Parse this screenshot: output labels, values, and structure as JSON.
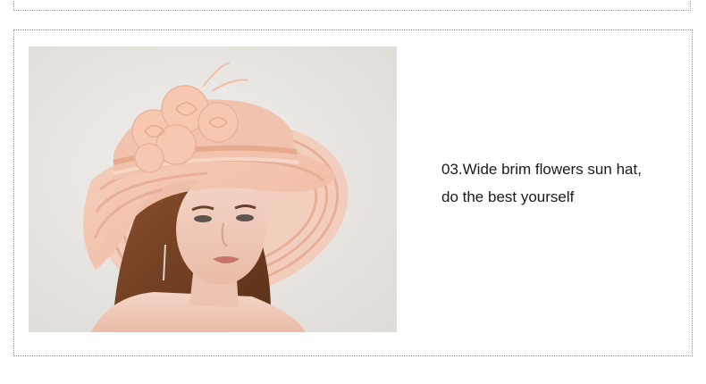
{
  "product": {
    "image_icon": "hat-photo",
    "caption_line1": "03.Wide brim flowers sun hat,",
    "caption_line2": "do the best yourself"
  },
  "colors": {
    "hat_pink": "#f3c2ad",
    "background": "#ffffff",
    "text": "#1a1a1a"
  }
}
